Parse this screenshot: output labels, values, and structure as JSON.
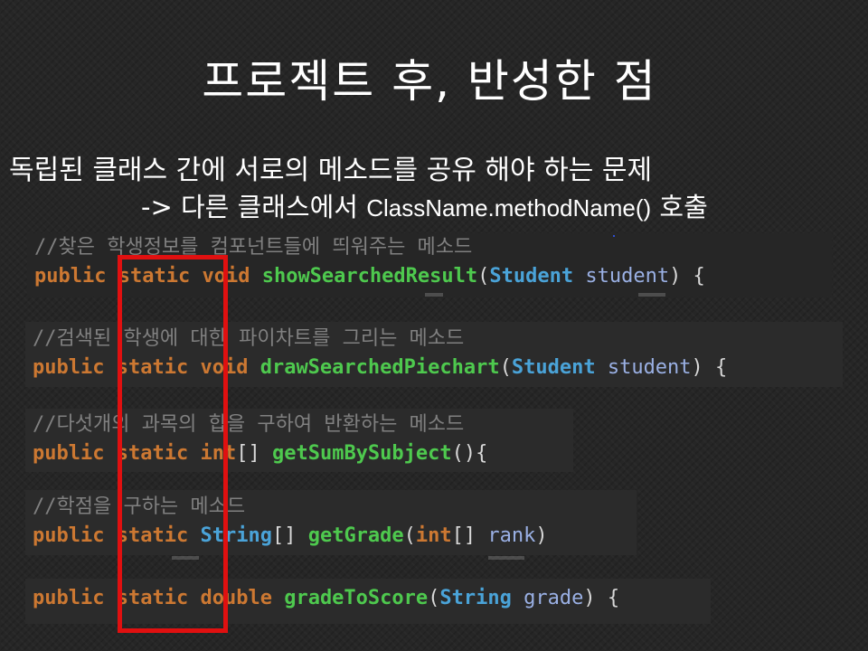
{
  "slide": {
    "title": "프로젝트 후, 반성한 점",
    "problem": "독립된 클래스 간에 서로의 메소드를 공유 해야 하는 문제",
    "solution_prefix": "-> 다른 클래스에서 ",
    "solution_code": "ClassName.methodName()",
    "solution_suffix": " 호출"
  },
  "code_blocks": [
    {
      "comment": "//찾은 학생정보를 컴포넌트들에 띄워주는 메소드",
      "public": "public",
      "static": "static",
      "return_type": "void",
      "method": "showSearchedResult",
      "open_paren": "(",
      "param_type": "Student",
      "param_name": "student",
      "close": ") {"
    },
    {
      "comment": "//검색된 학생에 대한 파이차트를 그리는 메소드",
      "public": "public",
      "static": "static",
      "return_type": "void",
      "method": "drawSearchedPiechart",
      "open_paren": "(",
      "param_type": "Student",
      "param_name": "student",
      "close": ") {"
    },
    {
      "comment": "//다섯개의 과목의 합을 구하여 반환하는 메소드",
      "public": "public",
      "static": "static",
      "return_type": "int",
      "array_brackets": "[]",
      "method": "getSumBySubject",
      "rest": "(){"
    },
    {
      "comment": "//학점을 구하는 메소드",
      "public": "public",
      "static": "static",
      "return_type": "String",
      "array_brackets": "[]",
      "method": "getGrade",
      "open_paren": "(",
      "param_type": "int",
      "param_brackets": "[]",
      "param_name": "rank",
      "close": ")"
    },
    {
      "public": "public",
      "static": "static",
      "return_type": "double",
      "method": "gradeToScore",
      "open_paren": "(",
      "param_type": "String",
      "param_name": "grade",
      "close": ") {"
    }
  ],
  "colors": {
    "background": "#262626",
    "keyword": "#cc7832",
    "method": "#4ec94e",
    "type": "#4aa3d8",
    "comment": "#808080",
    "highlight": "#e01010"
  }
}
